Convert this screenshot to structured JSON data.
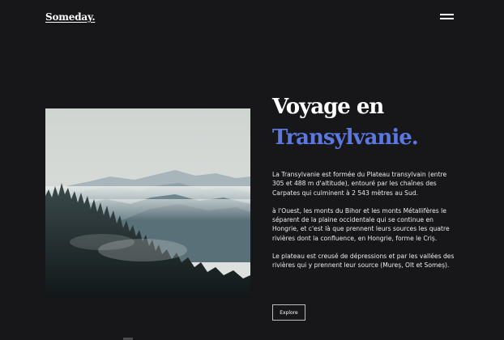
{
  "header": {
    "logo": "Someday.",
    "menu_icon": "hamburger-menu-icon"
  },
  "hero": {
    "title_line1": "Voyage en",
    "title_line2": "Transylvanie.",
    "image_description_icon": "mountain-forest-photo",
    "paragraphs": [
      "La Transylvanie est formée du Plateau transylvain (entre 305 et 488 m d'altitude), entouré par les chaînes des Carpates qui culminent à 2 543 mètres au Sud.",
      "à l'Ouest, les monts du Bihor et les monts Métallifères le séparent de la plaine occidentale qui se continue en Hongrie, et c'est là que prennent leurs sources les quatre rivières dont la confluence, en Hongrie, forme le Criș.",
      "Le plateau est creusé de dépressions et par les vallées des rivières qui y prennent leur source (Mureș, Olt et Someș)."
    ],
    "button_label": "Explore"
  },
  "colors": {
    "background": "#17171a",
    "accent": "#5b78e0",
    "text": "#ffffff"
  }
}
